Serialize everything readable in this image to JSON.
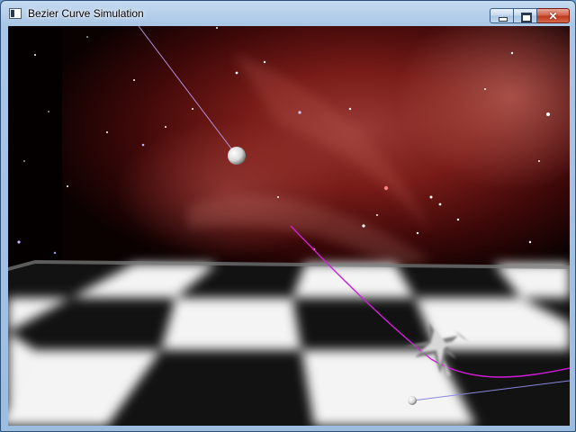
{
  "window": {
    "title": "Bezier Curve Simulation",
    "controls": {
      "minimize": "minimize",
      "maximize": "maximize",
      "close": "close"
    }
  },
  "scene": {
    "background": "red nebula starfield",
    "floor": "black-and-white checkerboard",
    "curve_color": "#d01ed8",
    "line_color": "#7b7bd6",
    "accent_colors": {
      "nebula": "#7a1a16",
      "sphere": "#ffffff"
    }
  }
}
